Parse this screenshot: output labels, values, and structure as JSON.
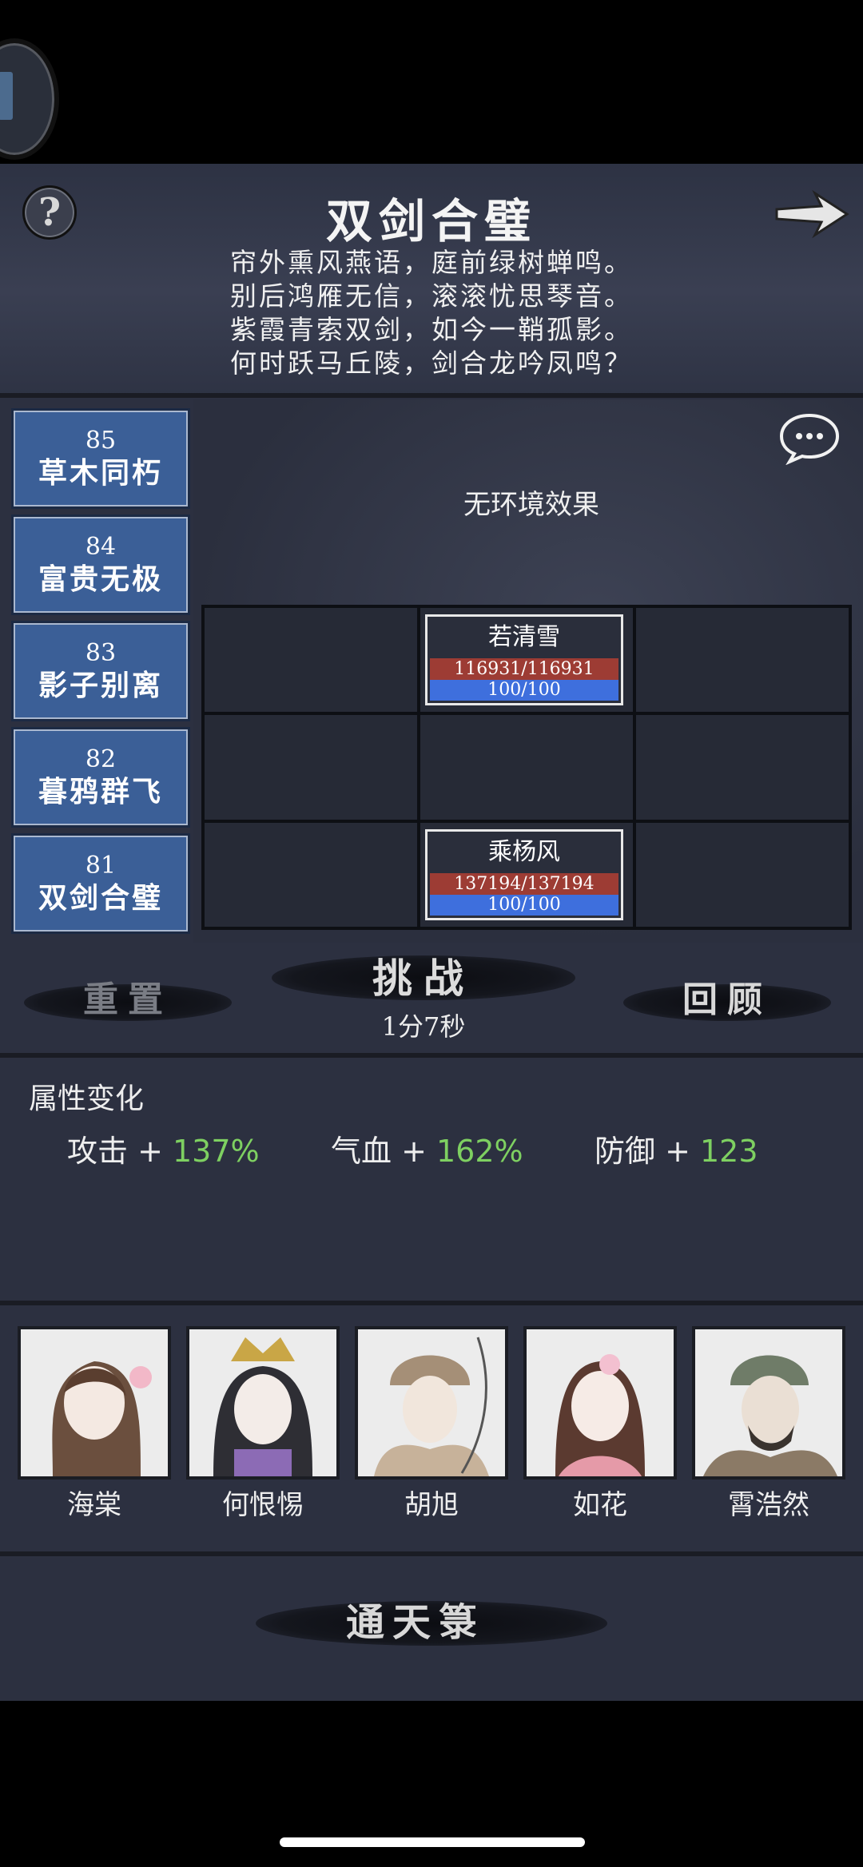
{
  "header": {
    "title": "双剑合璧",
    "help_label": "?",
    "poem": [
      "帘外熏风燕语，庭前绿树蝉鸣。",
      "别后鸿雁无信，滚滚忧思琴音。",
      "紫霞青索双剑，如今一鞘孤影。",
      "何时跃马丘陵，剑合龙吟凤鸣？"
    ]
  },
  "stages": [
    {
      "num": "85",
      "name": "草木同朽"
    },
    {
      "num": "84",
      "name": "富贵无极"
    },
    {
      "num": "83",
      "name": "影子别离"
    },
    {
      "num": "82",
      "name": "暮鸦群飞"
    },
    {
      "num": "81",
      "name": "双剑合璧"
    }
  ],
  "battle": {
    "environment": "无环境效果",
    "units": [
      {
        "name": "若清雪",
        "hp": "116931/116931",
        "mp": "100/100",
        "hp_fraction": 1.0,
        "mp_fraction": 1.0
      },
      {
        "name": "乘杨风",
        "hp": "137194/137194",
        "mp": "100/100",
        "hp_fraction": 1.0,
        "mp_fraction": 1.0
      }
    ]
  },
  "actions": {
    "reset": "重置",
    "challenge": "挑战",
    "timer": "1分7秒",
    "review": "回顾"
  },
  "attributes": {
    "title": "属性变化",
    "items": [
      {
        "label": "攻击 + ",
        "value": "137%"
      },
      {
        "label": "气血 + ",
        "value": "162%"
      },
      {
        "label": "防御 + ",
        "value": "123"
      }
    ]
  },
  "heroes": [
    {
      "name": "海棠"
    },
    {
      "name": "何恨惕"
    },
    {
      "name": "胡旭"
    },
    {
      "name": "如花"
    },
    {
      "name": "霄浩然"
    }
  ],
  "bottom": {
    "tongtian": "通天箓"
  },
  "colors": {
    "stage_bg": "#3b5f97",
    "hp_bar": "#9d3c34",
    "mp_bar": "#3e6fdd",
    "attr_value": "#7ed061"
  }
}
